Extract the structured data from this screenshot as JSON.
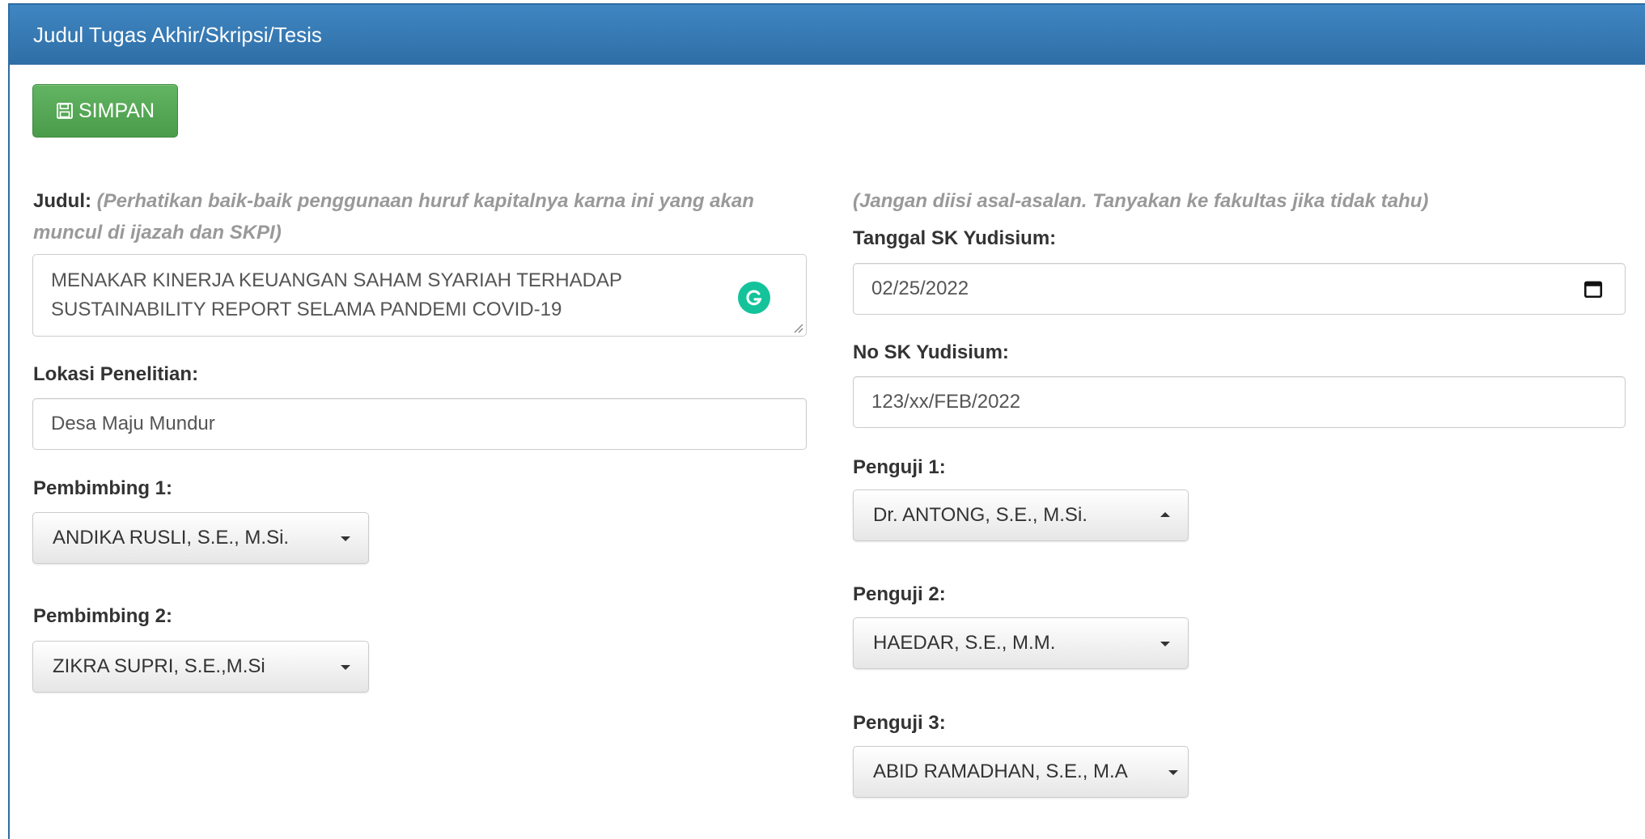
{
  "panel": {
    "title": "Judul Tugas Akhir/Skripsi/Tesis"
  },
  "toolbar": {
    "save_label": "SIMPAN",
    "save_icon": "floppy-disk-icon"
  },
  "left": {
    "judul": {
      "label": "Judul:",
      "hint": "(Perhatikan baik-baik penggunaan huruf kapitalnya karna ini yang akan muncul di ijazah dan SKPI)",
      "value_line1": "MENAKAR KINERJA KEUANGAN SAHAM SYARIAH TERHADAP",
      "value_line2": "SUSTAINABILITY REPORT SELAMA PANDEMI COVID-19"
    },
    "lokasi": {
      "label": "Lokasi Penelitian:",
      "value": "Desa Maju Mundur"
    },
    "pembimbing1": {
      "label": "Pembimbing 1:",
      "value": "ANDIKA RUSLI, S.E., M.Si."
    },
    "pembimbing2": {
      "label": "Pembimbing 2:",
      "value": "ZIKRA SUPRI, S.E.,M.Si"
    }
  },
  "right": {
    "hint": "(Jangan diisi asal-asalan. Tanyakan ke fakultas jika tidak tahu)",
    "tanggal": {
      "label": "Tanggal SK Yudisium:",
      "value": "02/25/2022"
    },
    "nosk": {
      "label": "No SK Yudisium:",
      "value": "123/xx/FEB/2022"
    },
    "penguji1": {
      "label": "Penguji 1:",
      "value": "Dr. ANTONG, S.E., M.Si."
    },
    "penguji2": {
      "label": "Penguji 2:",
      "value": "HAEDAR, S.E., M.M."
    },
    "penguji3": {
      "label": "Penguji 3:",
      "value": "ABID RAMADHAN, S.E., M.A"
    }
  },
  "colors": {
    "header": "#337ab7",
    "success": "#5cb85c",
    "grammarly": "#15c39a"
  }
}
